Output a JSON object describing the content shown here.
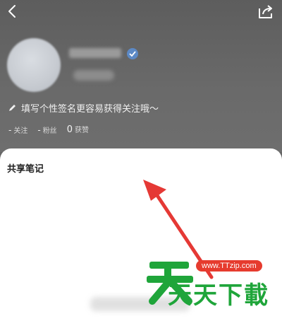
{
  "profile": {
    "signature": "填写个性签名更容易获得关注哦～",
    "stats": [
      {
        "value": "-",
        "label": "关注"
      },
      {
        "value": "-",
        "label": "粉丝"
      },
      {
        "value": "0",
        "label": "获赞"
      }
    ]
  },
  "sheet": {
    "title": "共享笔记"
  },
  "watermark": {
    "url": "www.TTzip.com",
    "text": "天天下載"
  },
  "colors": {
    "accent_arrow": "#e53935",
    "watermark_green": "#1fa53a",
    "watermark_red": "#e63b2e"
  }
}
